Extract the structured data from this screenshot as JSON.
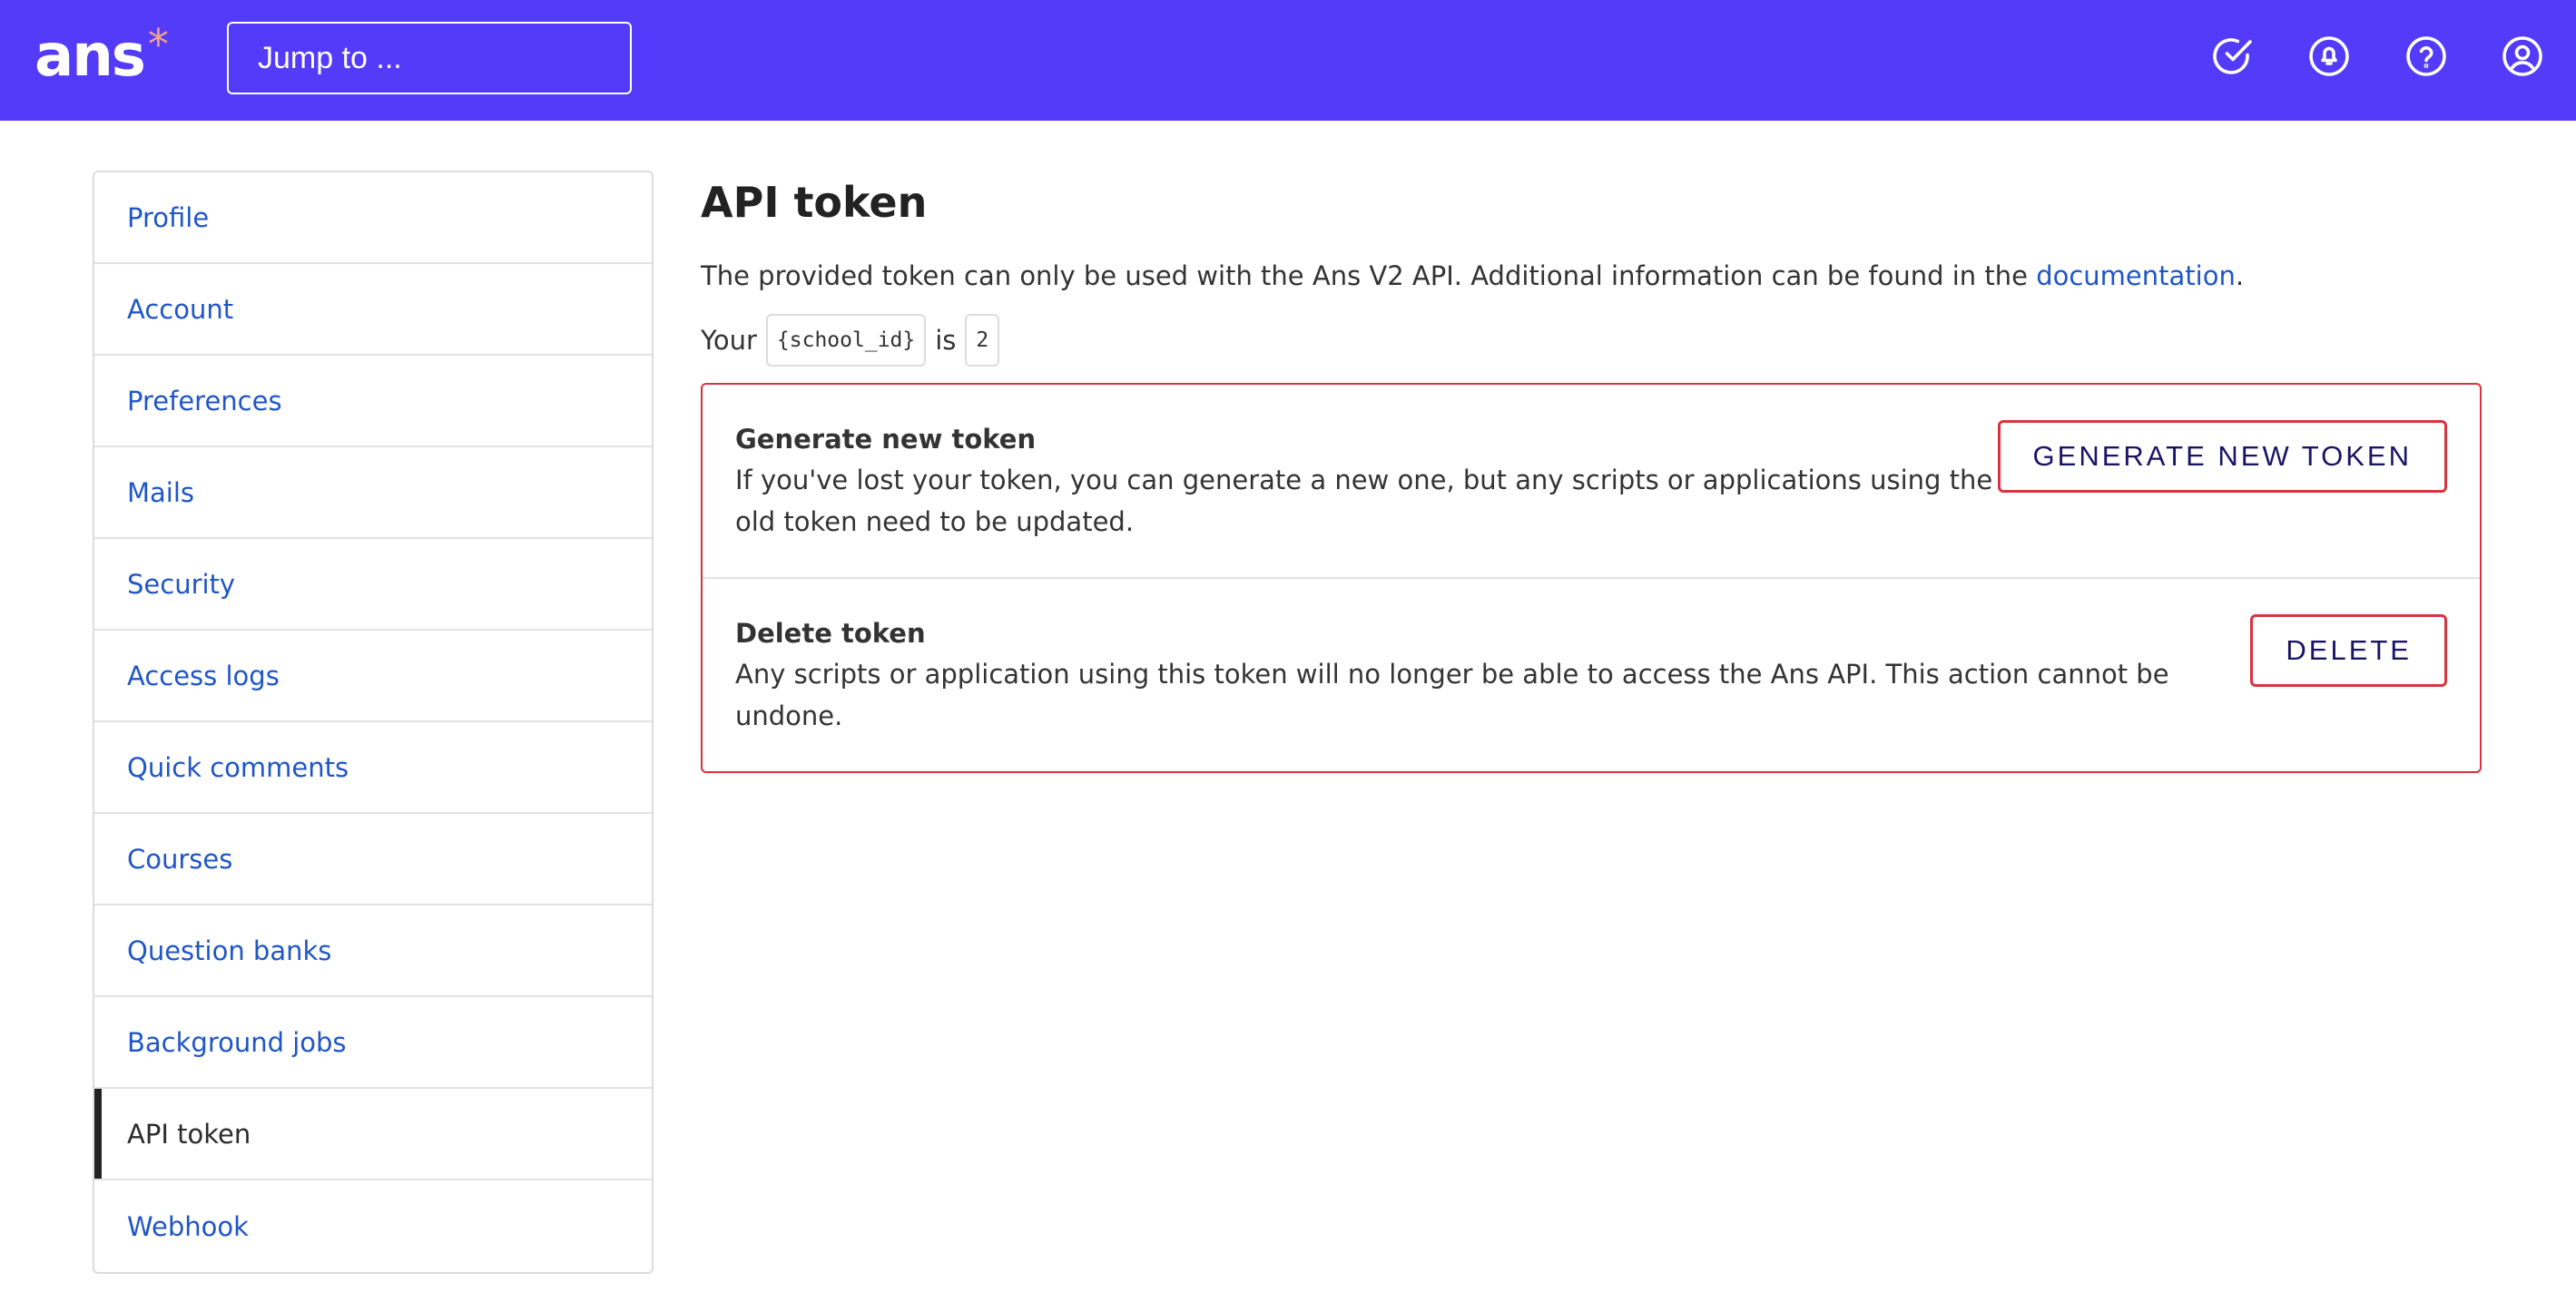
{
  "header": {
    "logo_text": "ans",
    "logo_mark": "*",
    "search_placeholder": "Jump to ...",
    "icons": [
      "check-circle-icon",
      "bell-icon",
      "help-icon",
      "user-icon"
    ],
    "background_color": "#543bfa",
    "accent_color": "#f2a38b"
  },
  "sidebar": {
    "items": [
      {
        "label": "Profile"
      },
      {
        "label": "Account"
      },
      {
        "label": "Preferences"
      },
      {
        "label": "Mails"
      },
      {
        "label": "Security"
      },
      {
        "label": "Access logs"
      },
      {
        "label": "Quick comments"
      },
      {
        "label": "Courses"
      },
      {
        "label": "Question banks"
      },
      {
        "label": "Background jobs"
      },
      {
        "label": "API token",
        "active": true
      },
      {
        "label": "Webhook"
      }
    ],
    "link_color": "#1f56c8"
  },
  "main": {
    "title": "API token",
    "intro_text": "The provided token can only be used with the Ans V2 API. Additional information can be found in the ",
    "intro_link": "documentation",
    "intro_end": ".",
    "school_prefix": "Your",
    "school_code": "{school_id}",
    "school_middle": "is",
    "school_value": "2",
    "danger_color": "#d9333f",
    "sections": [
      {
        "title": "Generate new token",
        "description": "If you've lost your token, you can generate a new one, but any scripts or applications using the old token need to be updated.",
        "button": "GENERATE NEW TOKEN"
      },
      {
        "title": "Delete token",
        "description": "Any scripts or application using this token will no longer be able to access the Ans API. This action cannot be undone.",
        "button": "DELETE"
      }
    ]
  }
}
